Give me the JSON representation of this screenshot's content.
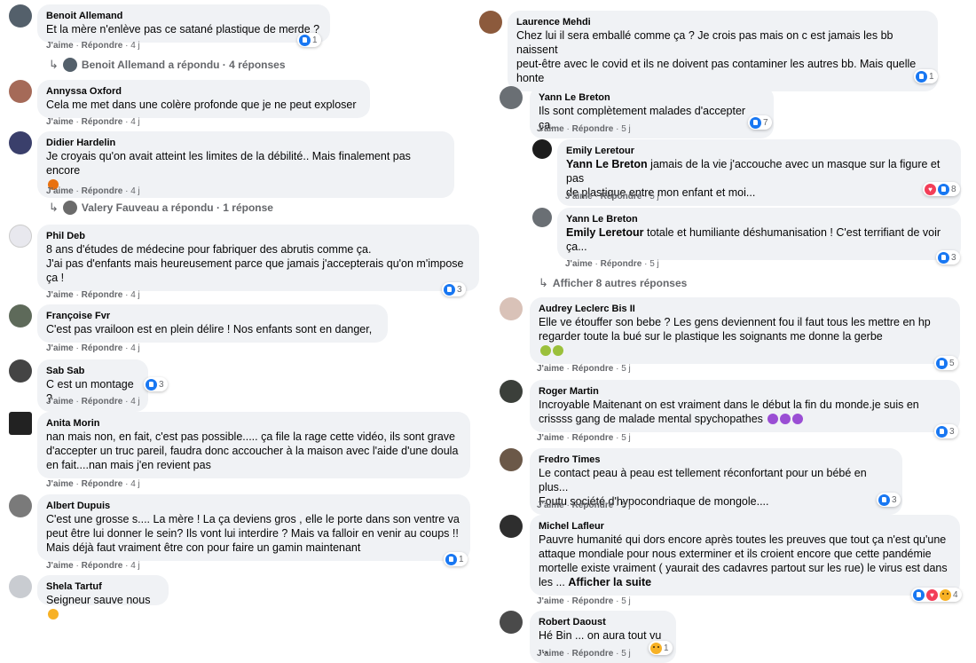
{
  "actions": {
    "like": "J'aime",
    "reply": "Répondre",
    "sep": " · "
  },
  "left": [
    {
      "name": "Benoit Allemand",
      "text": "Et la mère n'enlève pas ce satané plastique de merde ?",
      "time": "4 j",
      "reactions": "1",
      "replies": "Benoit Allemand a répondu · 4 réponses"
    },
    {
      "name": "Annyssa Oxford",
      "text": "Cela me met dans une colère profonde que je ne peut exploser",
      "time": "4 j"
    },
    {
      "name": "Didier Hardelin",
      "text": "Je croyais qu'on avait atteint les limites de la débilité.. Mais finalement pas encore",
      "time": "4 j",
      "replies": "Valery Fauveau a répondu · 1 réponse"
    },
    {
      "name": "Phil Deb",
      "text": "8 ans d'études de médecine pour fabriquer des abrutis comme ça.\nJ'ai pas d'enfants mais heureusement parce que jamais j'accepterais qu'on m'impose\nça !",
      "time": "4 j",
      "reactions": "3"
    },
    {
      "name": "Françoise Fvr",
      "text": "C'est pas vrailoon est en plein délire ! Nos enfants sont en danger,",
      "time": "4 j"
    },
    {
      "name": "Sab Sab",
      "text": "C est un montage ?",
      "time": "4 j",
      "reactions": "3"
    },
    {
      "name": "Anita Morin",
      "text": "nan mais non, en fait, c'est pas possible..... ça file la rage cette vidéo, ils sont grave\nd'accepter un truc pareil, faudra donc accoucher à la maison avec l'aide d'une doula\nen fait....nan mais j'en revient pas",
      "time": "4 j"
    },
    {
      "name": "Albert Dupuis",
      "text": "C'est une grosse s.... La mère ! La ça deviens gros , elle le porte dans son ventre va\npeut être lui donner le sein? Ils vont lui interdire ? Mais va falloir en venir au coups !!\nMais déjà faut vraiment être con pour faire un gamin maintenant",
      "time": "4 j",
      "reactions": "1"
    },
    {
      "name": "Shela Tartuf",
      "text": "Seigneur sauve nous"
    }
  ],
  "right": [
    {
      "name": "Laurence Mehdi",
      "text": "Chez lui il sera emballé comme ça ? Je crois pas mais on c est jamais les bb naissent\npeut-être avec le covid et ils ne doivent pas contaminer les autres bb. Mais quelle\nhonte",
      "reactions": "1"
    },
    {
      "name": "Yann Le Breton",
      "text": "Ils sont complètement malades d'accepter ça...",
      "time": "5 j",
      "reactions": "7"
    },
    {
      "name": "Emily Leretour",
      "mention": "Yann Le Breton",
      "text": " jamais de la vie j'accouche avec un masque sur la figure et pas\nde plastique entre mon enfant et moi...",
      "time": "5 j",
      "reactions": "8"
    },
    {
      "name": "Yann Le Breton",
      "mention": "Emily Leretour",
      "text": " totale et humiliante déshumanisation ! C'est terrifiant de voir\nça...",
      "time": "5 j",
      "reactions": "3"
    },
    {
      "more": "Afficher 8 autres réponses"
    },
    {
      "name": "Audrey Leclerc Bis II",
      "text": "Elle ve étouffer son bebe ? Les gens deviennent fou il faut tous les mettre en hp\n regarder toute la bué sur le plastique les soignants me donne la gerbe\n",
      "time": "5 j",
      "reactions": "5"
    },
    {
      "name": "Roger Martin",
      "text": "Incroyable Maitenant on est vraiment dans le début la fin du monde.je suis en\ncrissss gang de malade mental spychopathes ",
      "time": "5 j",
      "reactions": "3"
    },
    {
      "name": "Fredro Times",
      "text": "Le contact peau à peau est tellement réconfortant pour un bébé en plus...\nFoutu société d'hypocondriaque de mongole....",
      "time": "5 j",
      "reactions": "3"
    },
    {
      "name": "Michel Lafleur",
      "text": "Pauvre humanité qui dors encore après toutes les preuves que tout ça n'est qu'une\nattaque mondiale pour nous exterminer et ils croient encore que cette pandémie\nmortelle existe vraiment ( yaurait des cadavres partout sur les rue) le virus est dans\nles ... ",
      "see_more": "Afficher la suite",
      "time": "5 j",
      "reactions": "4"
    },
    {
      "name": "Robert Daoust",
      "text": "Hé Bin ... on aura tout vu ...",
      "time": "5 j",
      "reactions": "1"
    }
  ],
  "colors": {
    "bubble": "#f0f2f5",
    "like": "#1877f2",
    "meta": "#65676b"
  }
}
